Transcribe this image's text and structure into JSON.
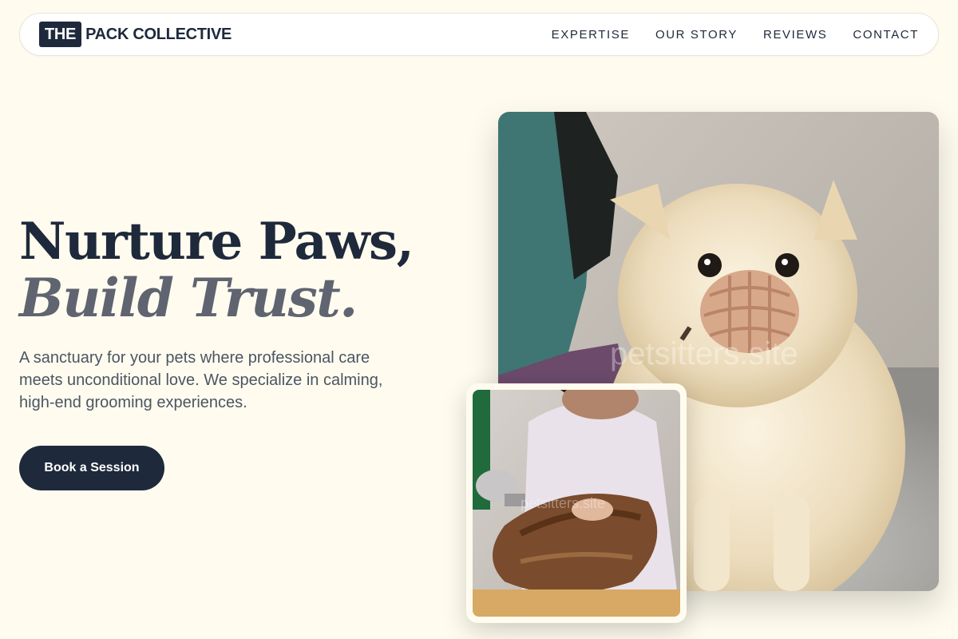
{
  "brand": {
    "logo_box": "THE",
    "logo_text": "PACK COLLECTIVE"
  },
  "nav": {
    "links": [
      "EXPERTISE",
      "OUR STORY",
      "REVIEWS",
      "CONTACT"
    ]
  },
  "hero": {
    "headline_line1": "Nurture Paws,",
    "headline_line2": "Build Trust.",
    "subtext": "A sanctuary for your pets where professional care meets unconditional love. We specialize in calming, high-end grooming experiences.",
    "cta_label": "Book a Session"
  },
  "images": {
    "main_alt": "Fluffy cream Pomeranian wearing a muzzle on a grooming table",
    "main_watermark": "petsitters.site",
    "small_alt": "Groomer blow-drying a long-haired dog",
    "small_watermark": "petsitters.site"
  },
  "colors": {
    "background": "#fffcef",
    "primary": "#1e293b",
    "accent_text": "#5f6470"
  }
}
